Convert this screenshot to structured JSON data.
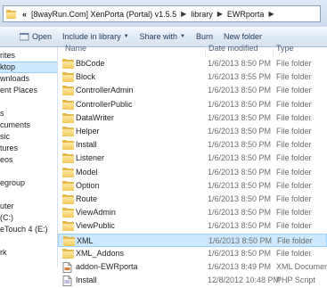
{
  "address": {
    "chevron": "«",
    "crumbs": [
      "[8wayRun.Com] XenPorta (Portal) v1.5.5",
      "library",
      "EWRporta"
    ],
    "separator": "▶"
  },
  "toolbar": {
    "items": [
      {
        "label": "Open",
        "dropdown": false
      },
      {
        "label": "Include in library",
        "dropdown": true
      },
      {
        "label": "Share with",
        "dropdown": true
      },
      {
        "label": "Burn",
        "dropdown": false
      },
      {
        "label": "New folder",
        "dropdown": false
      }
    ]
  },
  "nav": {
    "items": [
      {
        "label": "rites"
      },
      {
        "label": "ktop",
        "selected": true
      },
      {
        "label": "wnloads"
      },
      {
        "label": "ent Places"
      },
      {
        "label": ""
      },
      {
        "label": "s"
      },
      {
        "label": "cuments"
      },
      {
        "label": "sic"
      },
      {
        "label": "tures"
      },
      {
        "label": "eos"
      },
      {
        "label": ""
      },
      {
        "label": "egroup"
      },
      {
        "label": ""
      },
      {
        "label": "uter"
      },
      {
        "label": "(C:)"
      },
      {
        "label": "eTouch 4 (E:)"
      },
      {
        "label": ""
      },
      {
        "label": "rk"
      }
    ]
  },
  "columns": {
    "name": "Name",
    "date": "Date modified",
    "type": "Type"
  },
  "files": [
    {
      "name": "BbCode",
      "date": "1/6/2013 8:50 PM",
      "type": "File folder",
      "icon": "folder-icon"
    },
    {
      "name": "Block",
      "date": "1/6/2013 8:55 PM",
      "type": "File folder",
      "icon": "folder-icon"
    },
    {
      "name": "ControllerAdmin",
      "date": "1/6/2013 8:50 PM",
      "type": "File folder",
      "icon": "folder-icon"
    },
    {
      "name": "ControllerPublic",
      "date": "1/6/2013 8:50 PM",
      "type": "File folder",
      "icon": "folder-icon"
    },
    {
      "name": "DataWriter",
      "date": "1/6/2013 8:50 PM",
      "type": "File folder",
      "icon": "folder-icon"
    },
    {
      "name": "Helper",
      "date": "1/6/2013 8:50 PM",
      "type": "File folder",
      "icon": "folder-icon"
    },
    {
      "name": "Install",
      "date": "1/6/2013 8:50 PM",
      "type": "File folder",
      "icon": "folder-icon"
    },
    {
      "name": "Listener",
      "date": "1/6/2013 8:50 PM",
      "type": "File folder",
      "icon": "folder-icon"
    },
    {
      "name": "Model",
      "date": "1/6/2013 8:50 PM",
      "type": "File folder",
      "icon": "folder-icon"
    },
    {
      "name": "Option",
      "date": "1/6/2013 8:50 PM",
      "type": "File folder",
      "icon": "folder-icon"
    },
    {
      "name": "Route",
      "date": "1/6/2013 8:50 PM",
      "type": "File folder",
      "icon": "folder-icon"
    },
    {
      "name": "ViewAdmin",
      "date": "1/6/2013 8:50 PM",
      "type": "File folder",
      "icon": "folder-icon"
    },
    {
      "name": "ViewPublic",
      "date": "1/6/2013 8:50 PM",
      "type": "File folder",
      "icon": "folder-icon"
    },
    {
      "name": "XML",
      "date": "1/6/2013 8:50 PM",
      "type": "File folder",
      "icon": "folder-icon",
      "selected": true
    },
    {
      "name": "XML_Addons",
      "date": "1/6/2013 8:50 PM",
      "type": "File folder",
      "icon": "folder-icon"
    },
    {
      "name": "addon-EWRporta",
      "date": "1/6/2013 8:49 PM",
      "type": "XML Document",
      "icon": "xml-file-icon"
    },
    {
      "name": "Install",
      "date": "12/8/2012 10:48 PM",
      "type": "PHP Script",
      "icon": "php-file-icon"
    }
  ],
  "colors": {
    "selection": "#cce8ff",
    "selection_border": "#99d1ff",
    "folder": "#e7b94a"
  }
}
